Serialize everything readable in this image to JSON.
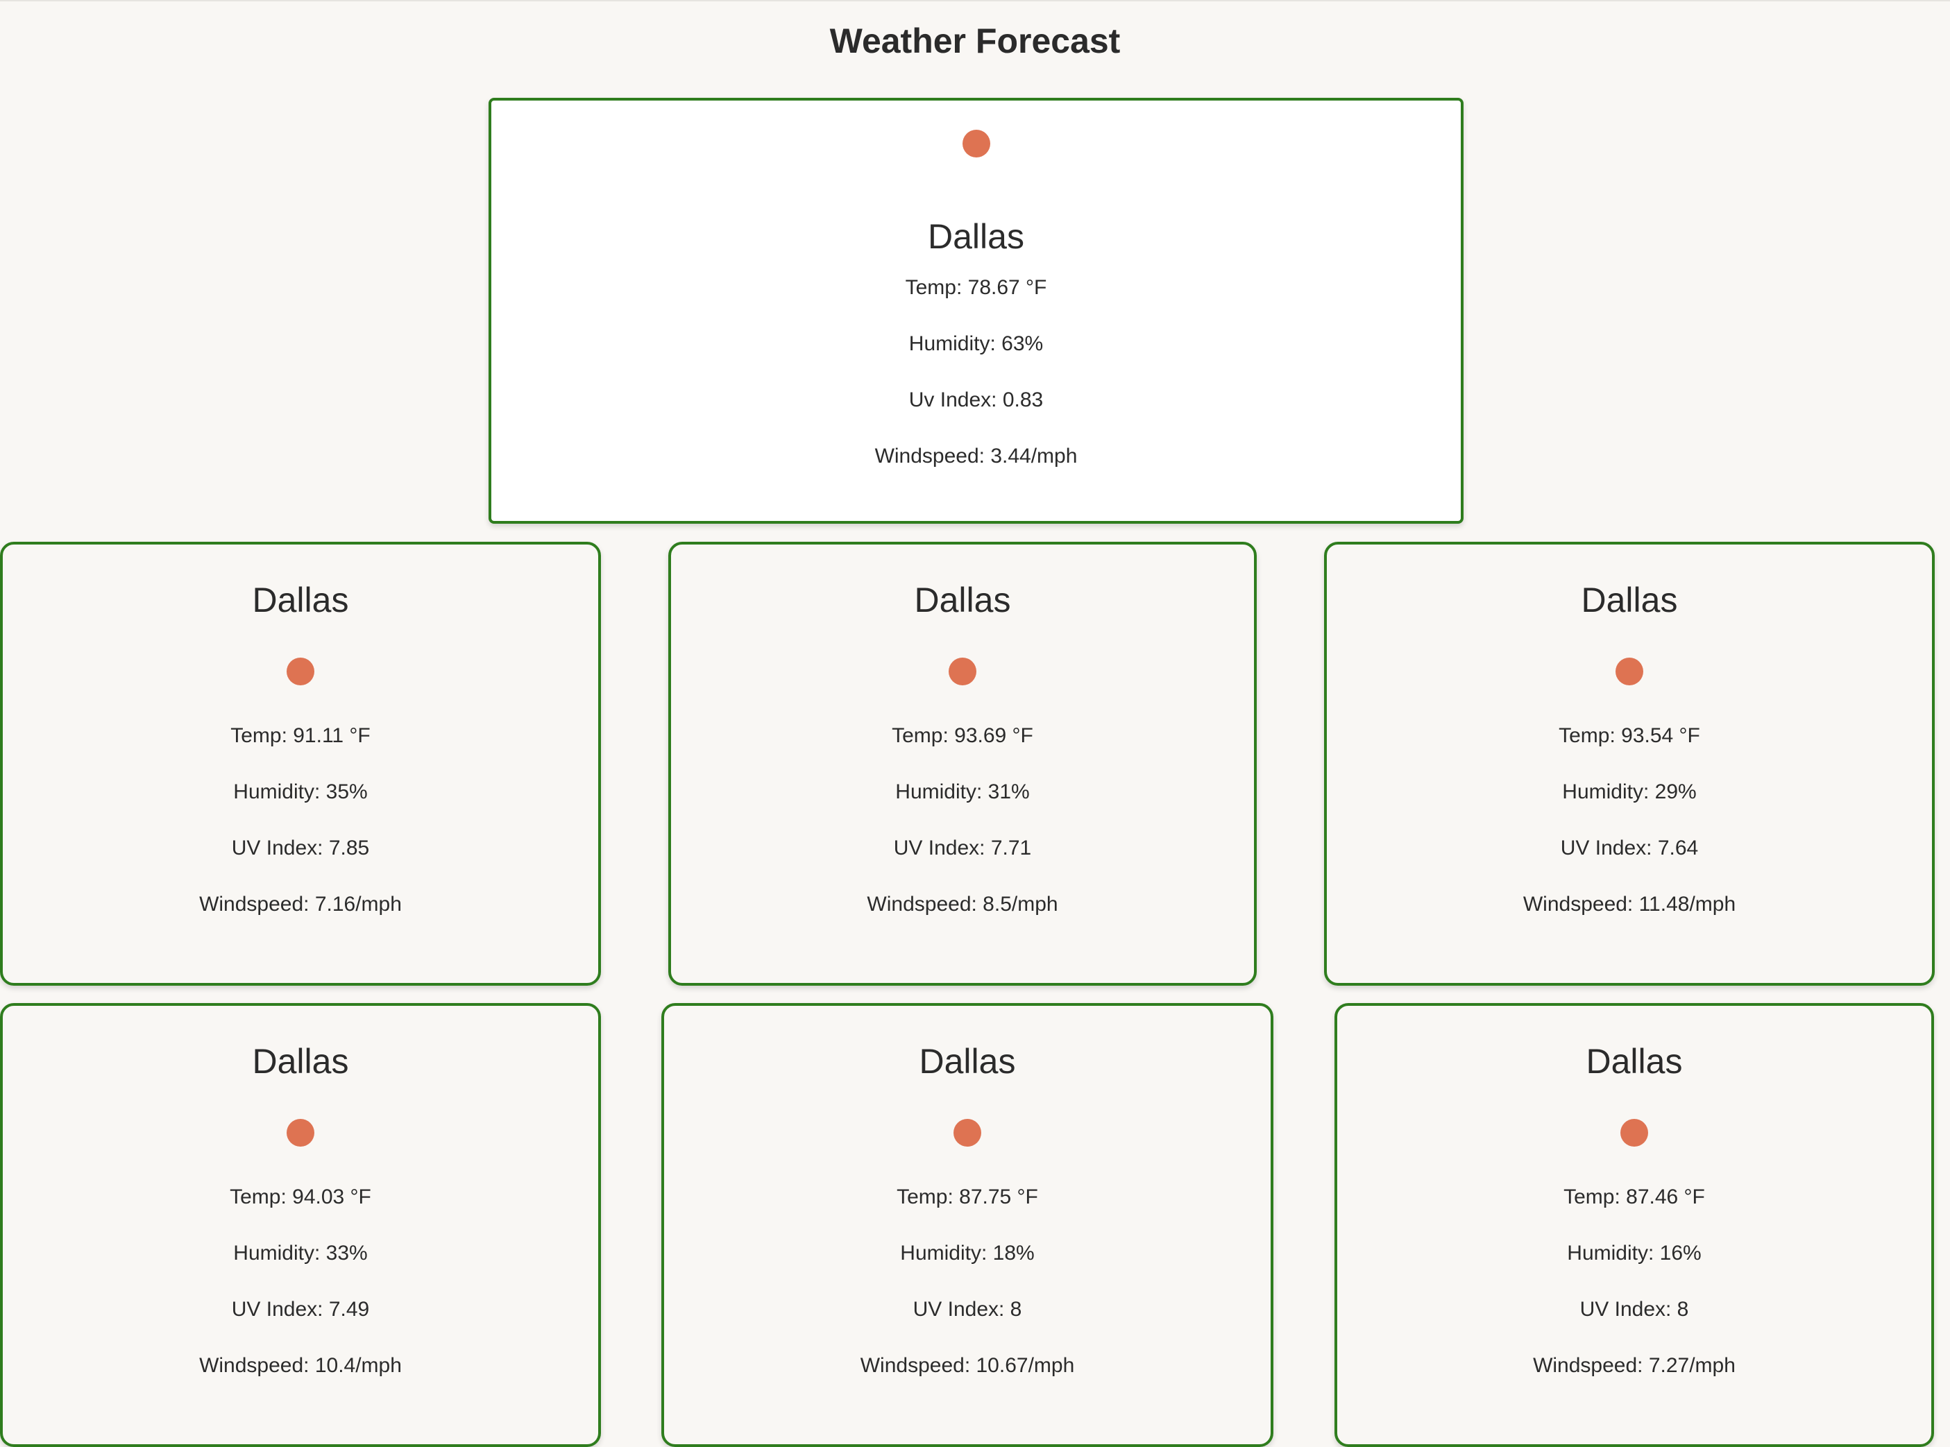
{
  "page": {
    "title": "Weather Forecast"
  },
  "colors": {
    "card_border": "#2f7d1e",
    "sun_icon": "#de7352",
    "background": "#f9f7f4"
  },
  "current": {
    "city": "Dallas",
    "icon": "sun-icon",
    "temp": "Temp: 78.67 °F",
    "humidity": "Humidity: 63%",
    "uv": "Uv Index: 0.83",
    "windspeed": "Windspeed: 3.44/mph"
  },
  "forecast": [
    {
      "city": "Dallas",
      "icon": "sun-icon",
      "temp": "Temp: 91.11 °F",
      "humidity": "Humidity: 35%",
      "uv": "UV Index: 7.85",
      "windspeed": "Windspeed: 7.16/mph"
    },
    {
      "city": "Dallas",
      "icon": "sun-icon",
      "temp": "Temp: 93.69 °F",
      "humidity": "Humidity: 31%",
      "uv": "UV Index: 7.71",
      "windspeed": "Windspeed: 8.5/mph"
    },
    {
      "city": "Dallas",
      "icon": "sun-icon",
      "temp": "Temp: 93.54 °F",
      "humidity": "Humidity: 29%",
      "uv": "UV Index: 7.64",
      "windspeed": "Windspeed: 11.48/mph"
    },
    {
      "city": "Dallas",
      "icon": "sun-icon",
      "temp": "Temp: 94.03 °F",
      "humidity": "Humidity: 33%",
      "uv": "UV Index: 7.49",
      "windspeed": "Windspeed: 10.4/mph"
    },
    {
      "city": "Dallas",
      "icon": "sun-icon",
      "temp": "Temp: 87.75 °F",
      "humidity": "Humidity: 18%",
      "uv": "UV Index: 8",
      "windspeed": "Windspeed: 10.67/mph"
    },
    {
      "city": "Dallas",
      "icon": "sun-icon",
      "temp": "Temp: 87.46 °F",
      "humidity": "Humidity: 16%",
      "uv": "UV Index: 8",
      "windspeed": "Windspeed: 7.27/mph"
    }
  ]
}
